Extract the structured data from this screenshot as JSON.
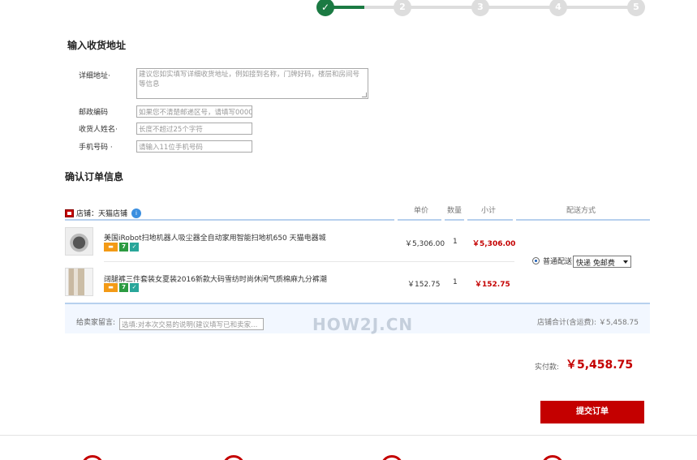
{
  "steps": [
    "✓",
    "2",
    "3",
    "4",
    "5"
  ],
  "address": {
    "title": "输入收货地址",
    "detail_label": "详细地址·",
    "detail_placeholder": "建议您如实填写详细收货地址，例如接到名称，门牌好码，楼层和房间号等信息",
    "zip_label": "邮政编码",
    "zip_placeholder": "如果您不清楚邮递区号，请填写0000",
    "name_label": "收货人姓名·",
    "name_placeholder": "长度不超过25个字符",
    "phone_label": "手机号码 ·",
    "phone_placeholder": "请输入11位手机号码"
  },
  "order": {
    "title": "确认订单信息",
    "store_name": "店铺：天猫店铺",
    "columns": {
      "unit_price": "单价",
      "quantity": "数量",
      "subtotal": "小计",
      "delivery": "配送方式"
    },
    "items": [
      {
        "title": "美国iRobot扫地机器人吸尘器全自动家用智能扫地机650 天猫电器城",
        "unit_price": "￥5,306.00",
        "quantity": "1",
        "subtotal": "￥5,306.00"
      },
      {
        "title": "阔腿裤三件套装女夏装2016新款大码雪纺时尚休闲气质棉麻九分裤潮",
        "unit_price": "￥152.75",
        "quantity": "1",
        "subtotal": "￥152.75"
      }
    ],
    "delivery_option": "普通配送",
    "delivery_select": "快递 免邮费",
    "message_label": "给卖家留言:",
    "message_placeholder": "选填:对本次交易的说明(建议填写已和卖家...",
    "watermark": "HOW2J.CN",
    "store_total": "店铺合计(含运费): ￥5,458.75",
    "pay_label": "实付款:",
    "pay_amount": "￥5,458.75",
    "submit_label": "提交订单"
  },
  "colors": {
    "accent": "#c40000",
    "progress_done": "#1b7a43",
    "progress_todo": "#dddddd",
    "table_line": "#b7d0ee"
  }
}
